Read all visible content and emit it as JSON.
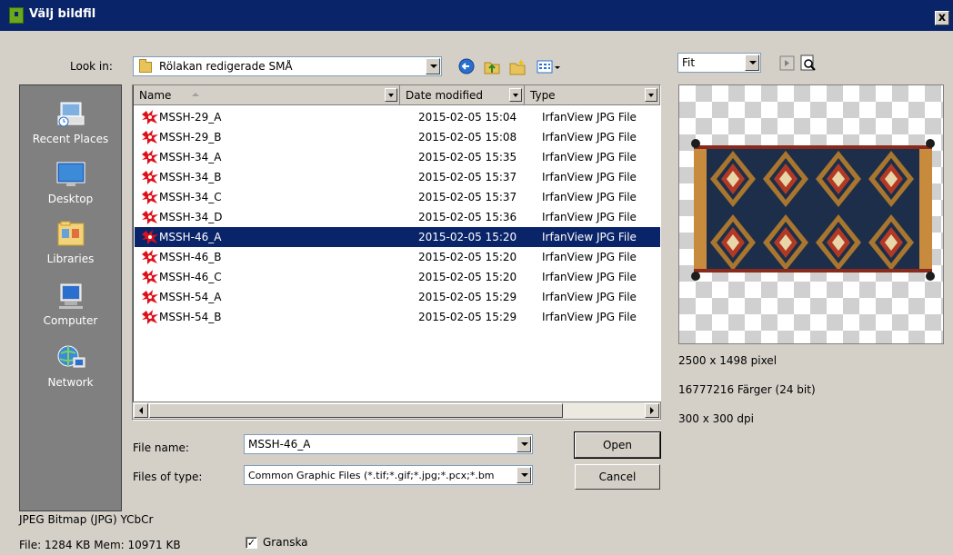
{
  "window": {
    "title": "Välj bildfil",
    "close_label": "x"
  },
  "toolbar": {
    "look_in_label": "Look in:",
    "look_in_value": "Rölakan redigerade SMÅ"
  },
  "places": [
    {
      "label": "Recent Places",
      "icon": "recent-places-icon"
    },
    {
      "label": "Desktop",
      "icon": "desktop-icon"
    },
    {
      "label": "Libraries",
      "icon": "libraries-icon"
    },
    {
      "label": "Computer",
      "icon": "computer-icon"
    },
    {
      "label": "Network",
      "icon": "network-icon"
    }
  ],
  "columns": {
    "name": "Name",
    "date": "Date modified",
    "type": "Type"
  },
  "files": [
    {
      "name": "MSSH-29_A",
      "date": "2015-02-05 15:04",
      "type": "IrfanView JPG File"
    },
    {
      "name": "MSSH-29_B",
      "date": "2015-02-05 15:08",
      "type": "IrfanView JPG File"
    },
    {
      "name": "MSSH-34_A",
      "date": "2015-02-05 15:35",
      "type": "IrfanView JPG File"
    },
    {
      "name": "MSSH-34_B",
      "date": "2015-02-05 15:37",
      "type": "IrfanView JPG File"
    },
    {
      "name": "MSSH-34_C",
      "date": "2015-02-05 15:37",
      "type": "IrfanView JPG File"
    },
    {
      "name": "MSSH-34_D",
      "date": "2015-02-05 15:36",
      "type": "IrfanView JPG File"
    },
    {
      "name": "MSSH-46_A",
      "date": "2015-02-05 15:20",
      "type": "IrfanView JPG File"
    },
    {
      "name": "MSSH-46_B",
      "date": "2015-02-05 15:20",
      "type": "IrfanView JPG File"
    },
    {
      "name": "MSSH-46_C",
      "date": "2015-02-05 15:20",
      "type": "IrfanView JPG File"
    },
    {
      "name": "MSSH-54_A",
      "date": "2015-02-05 15:29",
      "type": "IrfanView JPG File"
    },
    {
      "name": "MSSH-54_B",
      "date": "2015-02-05 15:29",
      "type": "IrfanView JPG File"
    }
  ],
  "selected_index": 6,
  "form": {
    "filename_label": "File name:",
    "filename_value": "MSSH-46_A",
    "filetype_label": "Files of type:",
    "filetype_value": "Common Graphic Files (*.tif;*.gif;*.jpg;*.pcx;*.bm",
    "open_label": "Open",
    "cancel_label": "Cancel"
  },
  "preview": {
    "zoom_value": "Fit",
    "dimensions": "2500 x 1498 pixel",
    "colors": "16777216 Färger (24 bit)",
    "dpi": "300 x 300 dpi"
  },
  "info": {
    "format": "JPEG Bitmap (JPG) YCbCr",
    "file_mem": "File: 1284 KB   Mem: 10971 KB",
    "preview_checkbox_label": "Granska",
    "preview_checked": true
  }
}
